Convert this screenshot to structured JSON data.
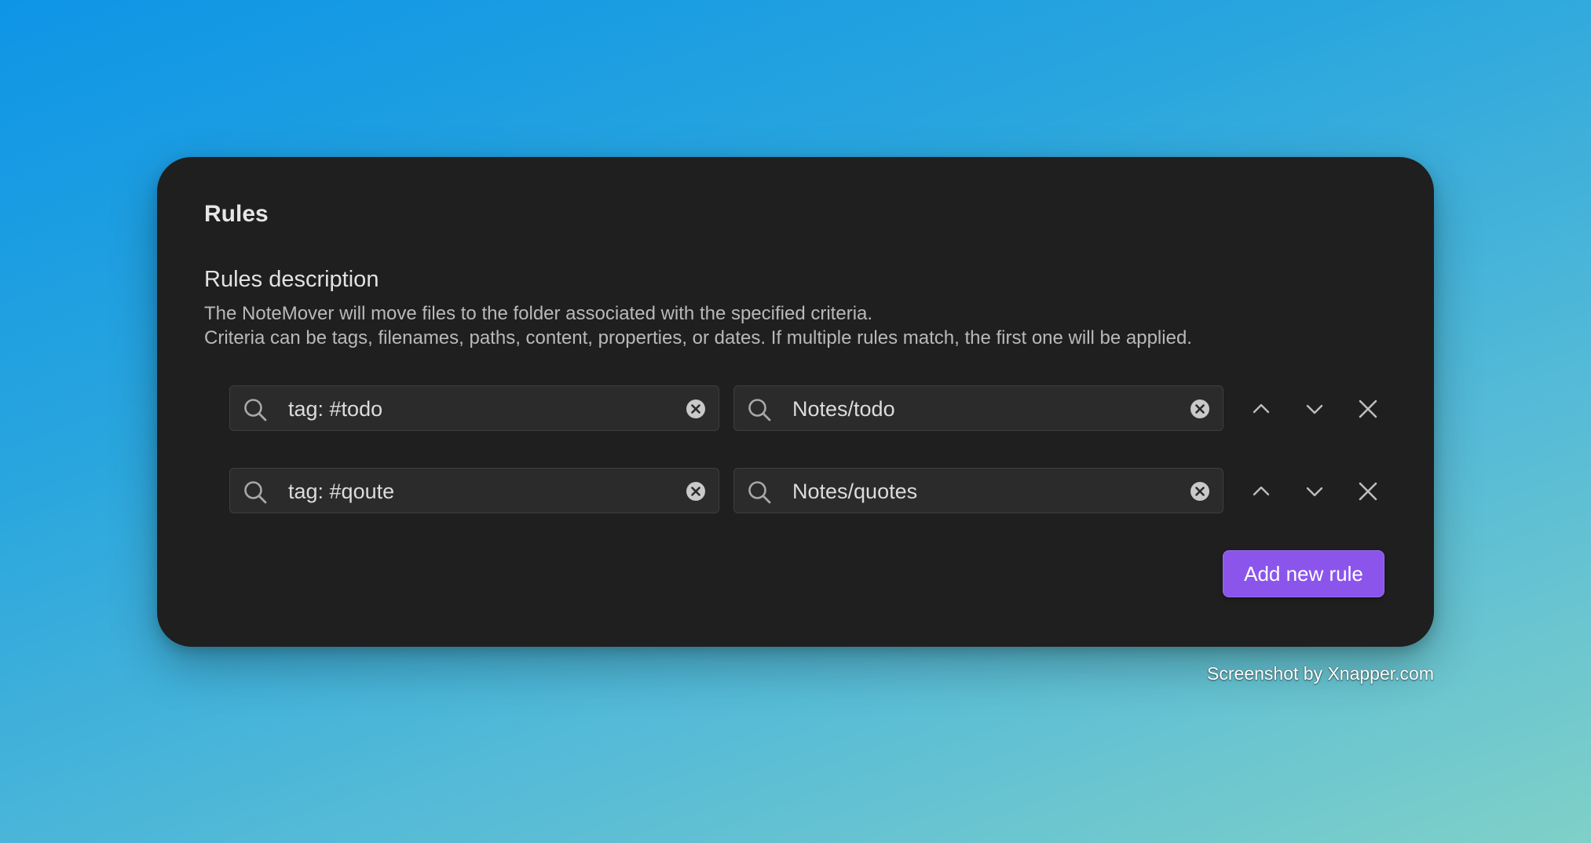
{
  "section": {
    "title": "Rules",
    "description_title": "Rules description",
    "description_lines": [
      "The NoteMover will move files to the folder associated with the specified criteria.",
      "Criteria can be tags, filenames, paths, content, properties, or dates. If multiple rules match, the first one will be applied."
    ]
  },
  "rules": [
    {
      "criteria": "tag: #todo",
      "folder": "Notes/todo"
    },
    {
      "criteria": "tag: #qoute",
      "folder": "Notes/quotes"
    }
  ],
  "add_button_label": "Add new rule",
  "watermark": "Screenshot by Xnapper.com",
  "icons": {
    "field": "search-icon",
    "clear": "clear-circle-icon",
    "move_up": "chevron-up-icon",
    "move_down": "chevron-down-icon",
    "delete": "close-icon"
  },
  "colors": {
    "panel_bg": "#1f1f1f",
    "field_bg": "#2b2b2b",
    "accent": "#8b55ec",
    "background_gradient": [
      "#0e95e6",
      "#7fd0c8"
    ]
  }
}
